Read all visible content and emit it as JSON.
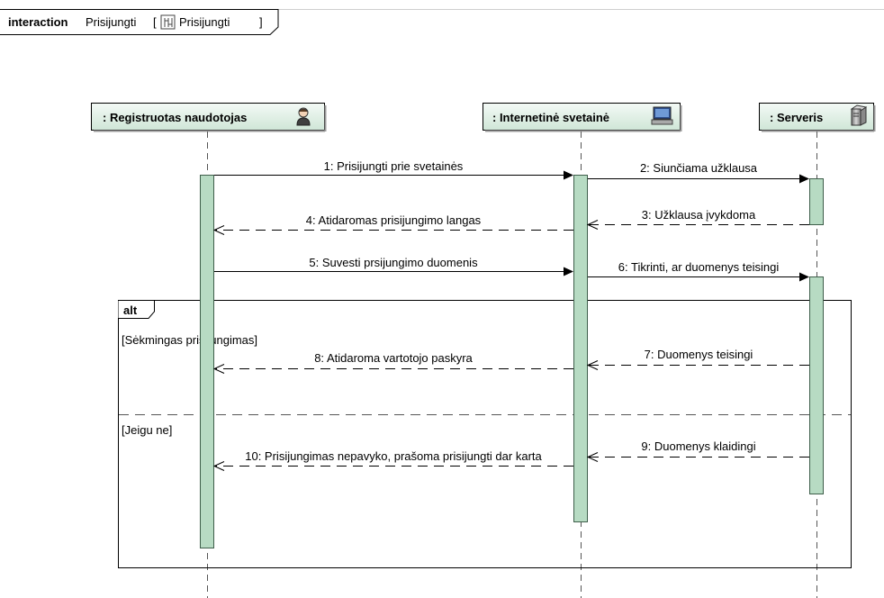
{
  "frame": {
    "keyword": "interaction",
    "name": "Prisijungti",
    "ref_name": "Prisijungti"
  },
  "lifelines": [
    {
      "id": "user",
      "label": ": Registruotas naudotojas",
      "icon": "user-icon"
    },
    {
      "id": "web",
      "label": ": Internetinė svetainė",
      "icon": "computer-icon"
    },
    {
      "id": "srv",
      "label": ": Serveris",
      "icon": "server-icon"
    }
  ],
  "messages": [
    {
      "id": "m1",
      "text": "1: Prisijungti prie svetainės",
      "from": "user",
      "to": "web",
      "kind": "sync"
    },
    {
      "id": "m2",
      "text": "2: Siunčiama užklausa",
      "from": "web",
      "to": "srv",
      "kind": "sync"
    },
    {
      "id": "m3",
      "text": "3: Užklausa įvykdoma",
      "from": "srv",
      "to": "web",
      "kind": "reply"
    },
    {
      "id": "m4",
      "text": "4: Atidaromas prisijungimo langas",
      "from": "web",
      "to": "user",
      "kind": "reply"
    },
    {
      "id": "m5",
      "text": "5: Suvesti prsijungimo duomenis",
      "from": "user",
      "to": "web",
      "kind": "sync"
    },
    {
      "id": "m6",
      "text": "6: Tikrinti, ar duomenys teisingi",
      "from": "web",
      "to": "srv",
      "kind": "sync"
    },
    {
      "id": "m7",
      "text": "7: Duomenys teisingi",
      "from": "srv",
      "to": "web",
      "kind": "reply"
    },
    {
      "id": "m8",
      "text": "8: Atidaroma vartotojo paskyra",
      "from": "web",
      "to": "user",
      "kind": "reply"
    },
    {
      "id": "m9",
      "text": "9: Duomenys klaidingi",
      "from": "srv",
      "to": "web",
      "kind": "reply"
    },
    {
      "id": "m10",
      "text": "10: Prisijungimas nepavyko, prašoma prisijungti dar karta",
      "from": "web",
      "to": "user",
      "kind": "reply"
    }
  ],
  "fragment": {
    "operator": "alt",
    "guards": [
      "[Sėkmingas prisijungimas]",
      "[Jeigu ne]"
    ]
  },
  "colors": {
    "lifeline_head_fill": "#dfeee3",
    "activation_fill": "#b7dbc3",
    "activation_stroke": "#3e5e4a",
    "line": "#000000"
  }
}
